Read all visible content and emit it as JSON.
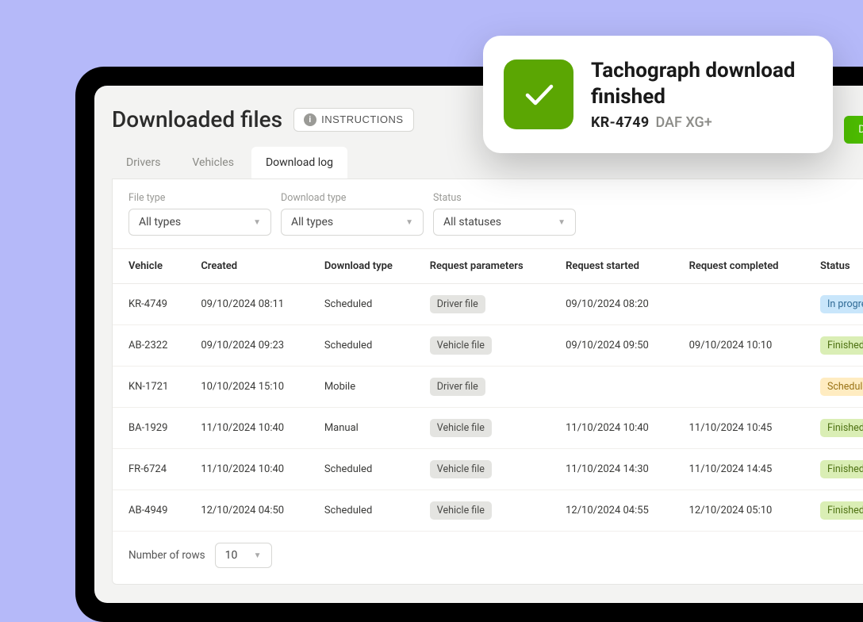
{
  "page": {
    "title": "Downloaded files",
    "instructions_label": "INSTRUCTIONS",
    "download_button": "DOWNLOAD"
  },
  "tabs": {
    "items": [
      {
        "label": "Drivers",
        "active": false
      },
      {
        "label": "Vehicles",
        "active": false
      },
      {
        "label": "Download log",
        "active": true
      }
    ]
  },
  "filters": {
    "file_type": {
      "label": "File type",
      "value": "All types"
    },
    "download_type": {
      "label": "Download type",
      "value": "All types"
    },
    "status": {
      "label": "Status",
      "value": "All statuses"
    }
  },
  "columns": {
    "vehicle": "Vehicle",
    "created": "Created",
    "download_type": "Download type",
    "request_parameters": "Request parameters",
    "request_started": "Request started",
    "request_completed": "Request completed",
    "status": "Status"
  },
  "rows": [
    {
      "vehicle": "KR-4749",
      "created": "09/10/2024 08:11",
      "download_type": "Scheduled",
      "params": "Driver file",
      "started": "09/10/2024 08:20",
      "completed": "",
      "status": "In progress",
      "status_kind": "inprogress"
    },
    {
      "vehicle": "AB-2322",
      "created": "09/10/2024 09:23",
      "download_type": "Scheduled",
      "params": "Vehicle file",
      "started": "09/10/2024 09:50",
      "completed": "09/10/2024 10:10",
      "status": "Finished",
      "status_kind": "finished"
    },
    {
      "vehicle": "KN-1721",
      "created": "10/10/2024 15:10",
      "download_type": "Mobile",
      "params": "Driver file",
      "started": "",
      "completed": "",
      "status": "Scheduled",
      "status_kind": "scheduled"
    },
    {
      "vehicle": "BA-1929",
      "created": "11/10/2024 10:40",
      "download_type": "Manual",
      "params": "Vehicle file",
      "started": "11/10/2024 10:40",
      "completed": "11/10/2024 10:45",
      "status": "Finished",
      "status_kind": "finished"
    },
    {
      "vehicle": "FR-6724",
      "created": "11/10/2024 10:40",
      "download_type": "Scheduled",
      "params": "Vehicle file",
      "started": "11/10/2024 14:30",
      "completed": "11/10/2024 14:45",
      "status": "Finished",
      "status_kind": "finished"
    },
    {
      "vehicle": "AB-4949",
      "created": "12/10/2024 04:50",
      "download_type": "Scheduled",
      "params": "Vehicle file",
      "started": "12/10/2024 04:55",
      "completed": "12/10/2024 05:10",
      "status": "Finished",
      "status_kind": "finished"
    }
  ],
  "pagination": {
    "rows_label": "Number of rows",
    "rows_value": "10"
  },
  "toast": {
    "title": "Tachograph download finished",
    "plate": "KR-4749",
    "model": "DAF XG+"
  }
}
